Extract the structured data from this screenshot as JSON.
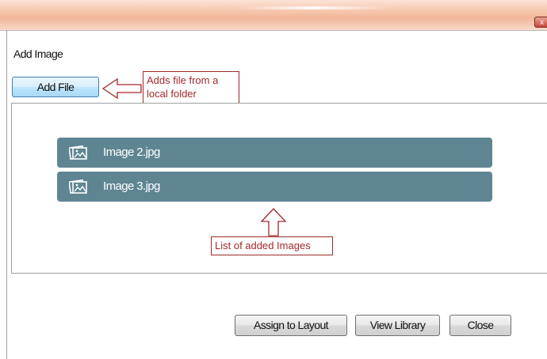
{
  "window": {
    "close_glyph": "x"
  },
  "dialog": {
    "heading": "Add Image",
    "add_file_label": "Add File"
  },
  "images": [
    {
      "name": "Image 2.jpg",
      "icon": "image-file-icon"
    },
    {
      "name": "Image 3.jpg",
      "icon": "image-file-icon"
    }
  ],
  "annotations": {
    "add_file_note": "Adds file from a local folder",
    "list_note": "List of added Images"
  },
  "footer": {
    "assign_label": "Assign to Layout",
    "library_label": "View Library",
    "close_label": "Close"
  },
  "colors": {
    "list_item_bg": "#5f8593",
    "annotation": "#a4282a",
    "title_bar": "#f2b79a"
  }
}
